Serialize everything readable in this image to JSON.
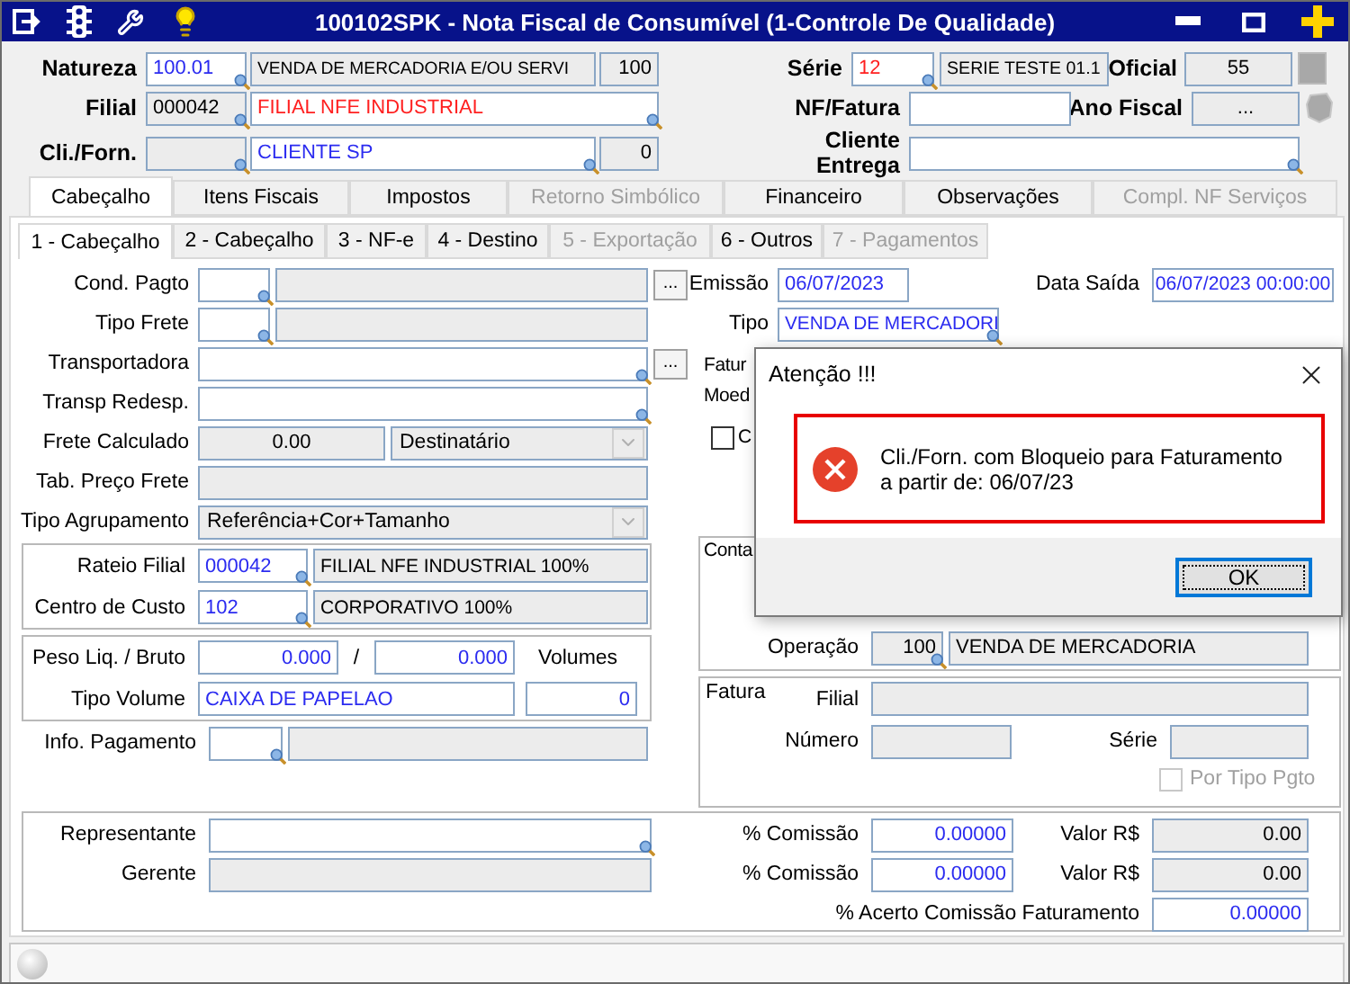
{
  "window": {
    "title": "100102SPK - Nota Fiscal de Consumível (1-Controle De Qualidade)"
  },
  "header": {
    "natureza": {
      "label": "Natureza",
      "code": {
        "value": "100.01",
        "color": "#2b2bf0",
        "readonly": false,
        "lookup": true
      },
      "description": {
        "value": "VENDA DE MERCADORIA E/OU SERVI",
        "readonly": true,
        "lookup": false
      },
      "number": {
        "value": "100",
        "readonly": true,
        "lookup": false
      }
    },
    "filial": {
      "label": "Filial",
      "code": {
        "value": "000042",
        "readonly": true,
        "lookup": true
      },
      "description": {
        "value": "FILIAL NFE INDUSTRIAL",
        "color": "#ff2020",
        "readonly": false,
        "lookup": true
      }
    },
    "cli_forn": {
      "label": "Cli./Forn.",
      "code": {
        "readonly": true,
        "lookup": true
      },
      "description": {
        "value": "CLIENTE SP",
        "color": "#2b2bf0",
        "readonly": false,
        "lookup": true
      },
      "number": {
        "value": "0",
        "readonly": true,
        "lookup": false
      }
    },
    "serie": {
      "label": "Série",
      "code": {
        "value": "12",
        "color": "#ff2020",
        "readonly": false,
        "lookup": true
      },
      "description": {
        "value": "SERIE TESTE 01.1",
        "readonly": true,
        "lookup": false
      }
    },
    "oficial": {
      "label": "Oficial",
      "field": {
        "value": "55",
        "readonly": true,
        "lookup": false
      }
    },
    "nf_fatura": {
      "label": "NF/Fatura",
      "field": {
        "readonly": false,
        "lookup": false
      }
    },
    "ano_fiscal": {
      "label": "Ano Fiscal",
      "field": {
        "value": "...",
        "readonly": true,
        "lookup": false
      }
    },
    "cliente_entrega": {
      "label": "Cliente Entrega",
      "field": {
        "readonly": false,
        "lookup": true
      }
    }
  },
  "tabs": [
    {
      "label": "Cabeçalho",
      "selected": true,
      "disabled": false
    },
    {
      "label": "Itens Fiscais",
      "selected": false,
      "disabled": false
    },
    {
      "label": "Impostos",
      "selected": false,
      "disabled": false
    },
    {
      "label": "Retorno Simbólico",
      "selected": false,
      "disabled": true
    },
    {
      "label": "Financeiro",
      "selected": false,
      "disabled": false
    },
    {
      "label": "Observações",
      "selected": false,
      "disabled": false
    },
    {
      "label": "Compl. NF Serviços",
      "selected": false,
      "disabled": true
    }
  ],
  "subtabs": [
    {
      "label": "1 - Cabeçalho",
      "selected": true,
      "disabled": false
    },
    {
      "label": "2 - Cabeçalho",
      "selected": false,
      "disabled": false
    },
    {
      "label": "3 - NF-e",
      "selected": false,
      "disabled": false
    },
    {
      "label": "4 - Destino",
      "selected": false,
      "disabled": false
    },
    {
      "label": "5 - Exportação",
      "selected": false,
      "disabled": true
    },
    {
      "label": "6 - Outros",
      "selected": false,
      "disabled": false
    },
    {
      "label": "7 - Pagamentos",
      "selected": false,
      "disabled": true
    }
  ],
  "form_left": {
    "cond_pagto": {
      "label": "Cond. Pagto",
      "code": {
        "readonly": false,
        "lookup": true
      },
      "description": {
        "readonly": true,
        "lookup": false
      },
      "button": "..."
    },
    "tipo_frete": {
      "label": "Tipo Frete",
      "code": {
        "readonly": false,
        "lookup": true
      },
      "description": {
        "readonly": true,
        "lookup": false
      }
    },
    "transportadora": {
      "label": "Transportadora",
      "field": {
        "readonly": false,
        "lookup": true
      },
      "button": "..."
    },
    "transp_redesp": {
      "label": "Transp Redesp.",
      "field": {
        "readonly": false,
        "lookup": true
      }
    },
    "frete_calculado": {
      "label": "Frete Calculado",
      "field": {
        "value": "0.00",
        "readonly": true,
        "lookup": false
      },
      "select": {
        "value": "Destinatário",
        "disabled": true
      }
    },
    "tab_preco_frete": {
      "label": "Tab. Preço Frete",
      "field": {
        "readonly": true,
        "lookup": false
      }
    },
    "tipo_agrupamento": {
      "label": "Tipo Agrupamento",
      "select": {
        "value": "Referência+Cor+Tamanho",
        "disabled": true
      }
    },
    "rateio_filial": {
      "label": "Rateio Filial",
      "code": {
        "value": "000042",
        "color": "#2b2bf0",
        "readonly": false,
        "lookup": true
      },
      "description": {
        "value": "FILIAL NFE INDUSTRIAL 100%",
        "readonly": true,
        "lookup": false
      }
    },
    "centro_custo": {
      "label": "Centro de Custo",
      "code": {
        "value": "102",
        "color": "#2b2bf0",
        "readonly": false,
        "lookup": true
      },
      "description": {
        "value": "CORPORATIVO 100%",
        "readonly": true,
        "lookup": false
      }
    },
    "peso": {
      "label": "Peso Liq. / Bruto",
      "liquido": {
        "value": "0.000",
        "color": "#2b2bf0",
        "readonly": false,
        "lookup": false
      },
      "separator": "/",
      "bruto": {
        "value": "0.000",
        "color": "#2b2bf0",
        "readonly": false,
        "lookup": false
      },
      "volumes_label": "Volumes"
    },
    "tipo_volume": {
      "label": "Tipo Volume",
      "field": {
        "value": "CAIXA DE PAPELAO",
        "color": "#2b2bf0",
        "readonly": false,
        "lookup": false
      },
      "volumes": {
        "value": "0",
        "color": "#2b2bf0",
        "readonly": false,
        "lookup": false
      }
    },
    "info_pagamento": {
      "label": "Info. Pagamento",
      "code": {
        "readonly": false,
        "lookup": true
      },
      "description": {
        "readonly": true,
        "lookup": false
      }
    }
  },
  "form_right": {
    "emissao": {
      "label": "Emissão",
      "field": {
        "value": "06/07/2023",
        "color": "#2b2bf0",
        "readonly": false,
        "lookup": false
      }
    },
    "data_saida": {
      "label": "Data Saída",
      "field": {
        "value": "06/07/2023 00:00:00",
        "color": "#2b2bf0",
        "readonly": false,
        "lookup": false
      }
    },
    "tipo": {
      "label": "Tipo",
      "field": {
        "value": "VENDA DE MERCADORI",
        "color": "#2b2bf0",
        "readonly": false,
        "lookup": true
      }
    },
    "partial_labels": [
      "Fatur",
      "Moed"
    ],
    "option": {
      "label": "C",
      "checked": false,
      "disabled": false
    },
    "conta": {
      "title": "Conta",
      "operacao": {
        "label": "Operação",
        "code": {
          "value": "100",
          "readonly": true,
          "lookup": true
        },
        "description": {
          "value": "VENDA DE MERCADORIA",
          "readonly": true,
          "lookup": false
        }
      }
    },
    "fatura": {
      "title": "Fatura",
      "filial": {
        "label": "Filial",
        "field": {
          "readonly": true,
          "lookup": false
        }
      },
      "numero": {
        "label": "Número",
        "field": {
          "readonly": true,
          "lookup": false
        }
      },
      "serie": {
        "label": "Série",
        "field": {
          "readonly": true,
          "lookup": false
        }
      },
      "por_tipo_pgto": {
        "label": "Por Tipo Pgto",
        "checked": false,
        "disabled": true
      }
    }
  },
  "bottom": {
    "representante": {
      "label": "Representante",
      "field": {
        "readonly": false,
        "lookup": true
      }
    },
    "gerente": {
      "label": "Gerente",
      "field": {
        "readonly": true,
        "lookup": false
      }
    },
    "comissoes": [
      {
        "label": "% Comissão",
        "field": {
          "value": "0.00000",
          "color": "#2b2bf0",
          "readonly": false,
          "lookup": false
        },
        "valor_label": "Valor R$",
        "valor": {
          "value": "0.00",
          "readonly": true,
          "lookup": false
        }
      },
      {
        "label": "% Comissão",
        "field": {
          "value": "0.00000",
          "color": "#2b2bf0",
          "readonly": false,
          "lookup": false
        },
        "valor_label": "Valor R$",
        "valor": {
          "value": "0.00",
          "readonly": true,
          "lookup": false
        }
      }
    ],
    "acerto": {
      "label": "% Acerto Comissão Faturamento",
      "field": {
        "value": "0.00000",
        "color": "#2b2bf0",
        "readonly": false,
        "lookup": false
      }
    }
  },
  "dialog": {
    "title": "Atenção !!!",
    "message_lines": [
      "Cli./Forn. com Bloqueio para Faturamento",
      "a partir de: 06/07/23"
    ],
    "button": {
      "label": "OK",
      "focused": true
    }
  }
}
